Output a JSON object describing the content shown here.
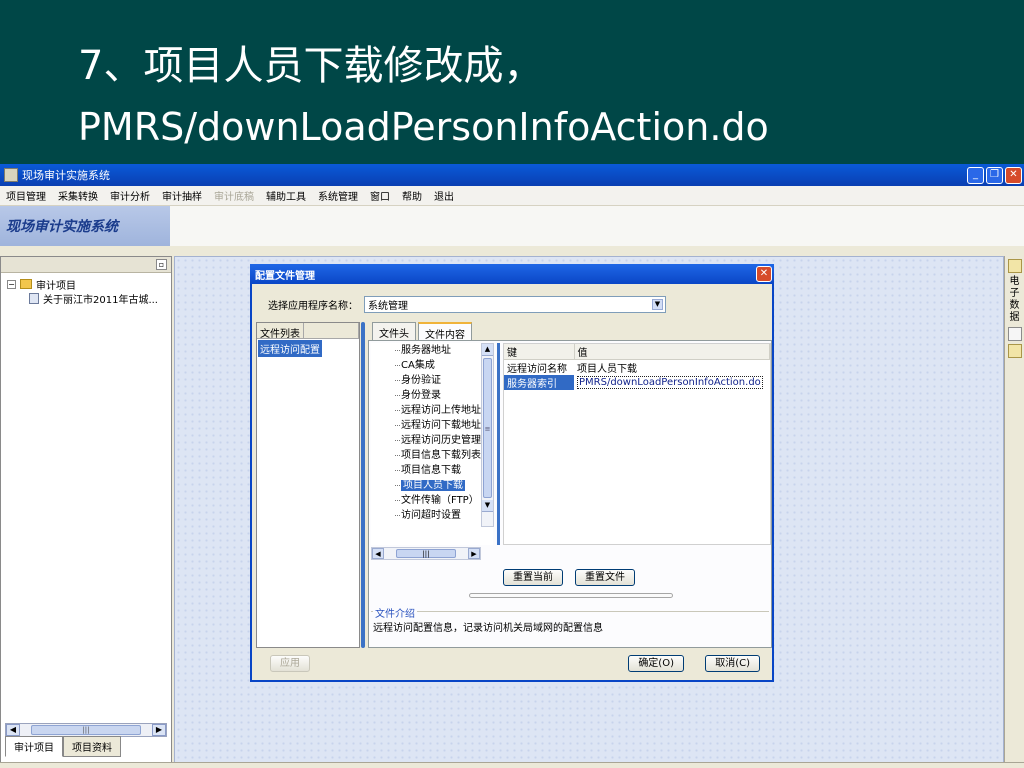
{
  "slide": {
    "title_line1": "7、项目人员下载修改成，",
    "title_line2": "PMRS/downLoadPersonInfoAction.do"
  },
  "window": {
    "title": "现场审计实施系统",
    "min_icon": "minimize-icon",
    "max_icon": "restore-icon",
    "close_icon": "close-icon"
  },
  "menu": [
    "项目管理",
    "采集转换",
    "审计分析",
    "审计抽样",
    "审计底稿",
    "辅助工具",
    "系统管理",
    "窗口",
    "帮助",
    "退出"
  ],
  "banner": {
    "logo_text": "现场审计实施系统"
  },
  "left_panel": {
    "tree_root": "审计项目",
    "tree_child": "关于丽江市2011年古城...",
    "tabs": [
      "审计项目",
      "项目资料"
    ]
  },
  "right_strip": {
    "label": "电子数据"
  },
  "dialog": {
    "title": "配置文件管理",
    "select_label": "选择应用程序名称：",
    "select_value": "系统管理",
    "file_list_header": "文件列表",
    "file_list_items": [
      "远程访问配置"
    ],
    "tabs": [
      "文件头",
      "文件内容"
    ],
    "key_items": [
      "服务器地址",
      "CA集成",
      "身份验证",
      "身份登录",
      "远程访问上传地址",
      "远程访问下载地址",
      "远程访问历史管理",
      "项目信息下载列表",
      "项目信息下载",
      "项目人员下载",
      "文件传输（FTP）",
      "访问超时设置"
    ],
    "selected_key": "项目人员下载",
    "table": {
      "col_key": "键",
      "col_value": "值",
      "rows": [
        {
          "key": "远程访问名称",
          "value": "项目人员下载"
        },
        {
          "key": "服务器索引",
          "value": "PMRS/downLoadPersonInfoAction.do"
        }
      ]
    },
    "btn_reset_current": "重置当前",
    "btn_reset_file": "重置文件",
    "info_title": "文件介绍",
    "info_text": "远程访问配置信息，记录访问机关局域网的配置信息",
    "btn_apply": "应用",
    "btn_ok": "确定(O)",
    "btn_cancel": "取消(C)"
  }
}
